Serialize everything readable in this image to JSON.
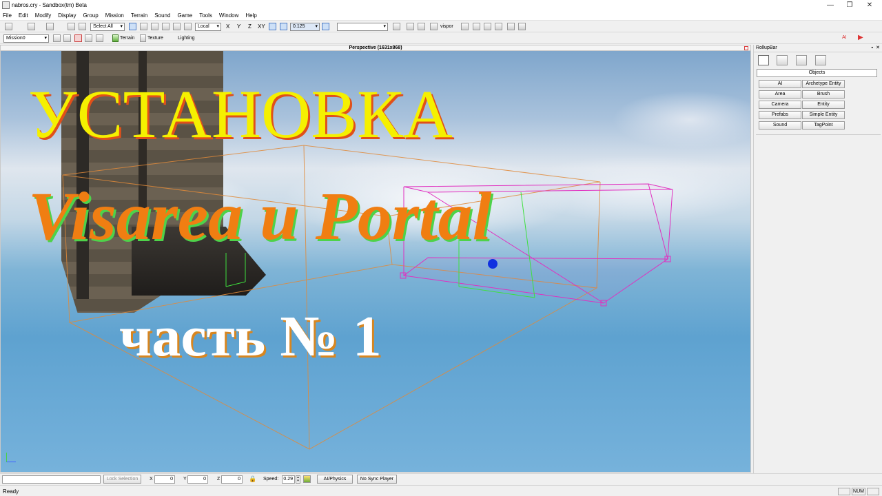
{
  "window": {
    "title": "nabros.cry - Sandbox(tm) Beta",
    "minimize": "—",
    "restore": "❐",
    "close": "✕"
  },
  "menu": [
    "File",
    "Edit",
    "Modify",
    "Display",
    "Group",
    "Mission",
    "Terrain",
    "Sound",
    "Game",
    "Tools",
    "Window",
    "Help"
  ],
  "toolbar1": {
    "select_filter": "Select All",
    "coord_system": "Local",
    "axes": [
      "X",
      "Y",
      "Z",
      "XY"
    ],
    "snap_value": "0.125",
    "vispor_label": "vispor"
  },
  "toolbar2": {
    "mission": "Mission0",
    "terrain_label": "Terrain",
    "texture_label": "Texture",
    "lighting_label": "Lighting"
  },
  "viewport": {
    "header": "Perspective (1631x868)",
    "overlay": {
      "line1": "УСТАНОВКА",
      "line2": "Visarea и Portal",
      "line3": "часть № 1"
    },
    "colors": {
      "line1": "#f5f000",
      "line2": "#f07e12",
      "line3": "#ffffff",
      "box_orange": "#e08a3a",
      "box_magenta": "#e030c0",
      "box_green": "#3ee03e",
      "gizmo_blue": "#1030e0"
    }
  },
  "rollup": {
    "title": "RollupBar",
    "category": "Objects",
    "buttons": [
      "AI",
      "Archetype Entity",
      "Area",
      "Brush",
      "Camera",
      "Entity",
      "Prefabs",
      "Simple Entity",
      "Sound",
      "TagPoint"
    ]
  },
  "bottom": {
    "lock_selection": "Lock Selection",
    "x_label": "X",
    "x_value": "0",
    "y_label": "Y",
    "y_value": "0",
    "z_label": "Z",
    "z_value": "0",
    "speed_label": "Speed:",
    "speed_value": "0.29",
    "ai_physics": "AI/Physics",
    "no_sync_player": "No Sync Player"
  },
  "status": {
    "text": "Ready",
    "num": "NUM"
  },
  "icons": [
    "undo-icon",
    "redo-icon",
    "link-icon",
    "unlink-icon",
    "select-icon",
    "move-icon",
    "rotate-icon",
    "scale-icon",
    "snap-grid-icon",
    "angle-snap-icon",
    "play-icon",
    "record-icon",
    "lock-icon"
  ]
}
